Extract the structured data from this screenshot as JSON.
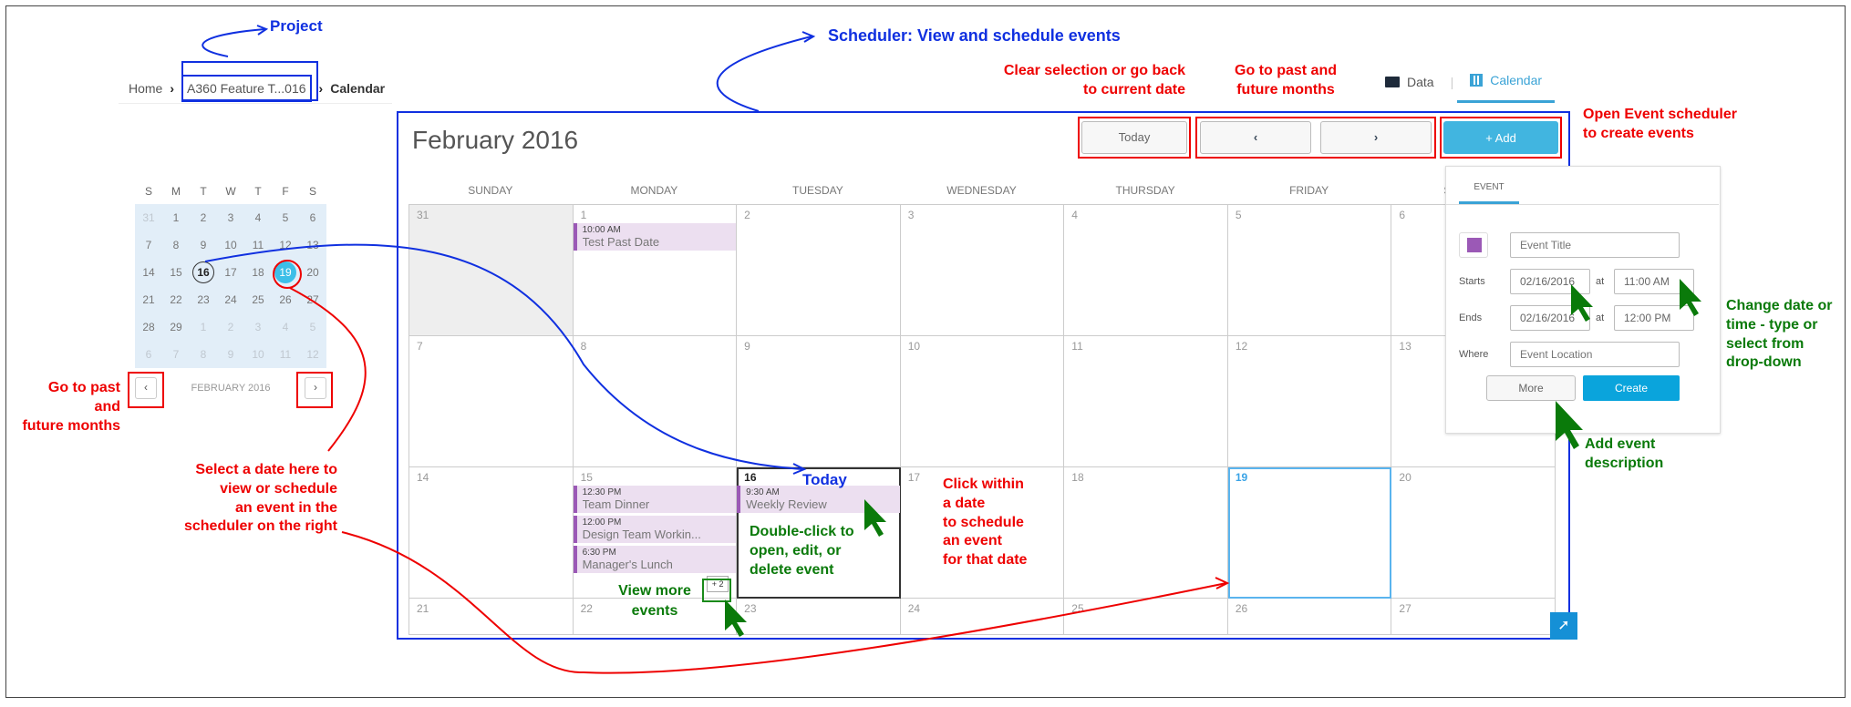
{
  "breadcrumb": {
    "home": "Home",
    "project": "A360 Feature T...016",
    "current": "Calendar"
  },
  "tabs": [
    {
      "label": "Data",
      "icon": "folder-icon"
    },
    {
      "label": "Calendar",
      "icon": "calendar-icon",
      "active": true
    }
  ],
  "mini_calendar": {
    "weekdays": [
      "S",
      "M",
      "T",
      "W",
      "T",
      "F",
      "S"
    ],
    "days": [
      {
        "d": "31",
        "out": true
      },
      {
        "d": "1"
      },
      {
        "d": "2"
      },
      {
        "d": "3"
      },
      {
        "d": "4"
      },
      {
        "d": "5"
      },
      {
        "d": "6"
      },
      {
        "d": "7"
      },
      {
        "d": "8"
      },
      {
        "d": "9"
      },
      {
        "d": "10"
      },
      {
        "d": "11"
      },
      {
        "d": "12"
      },
      {
        "d": "13"
      },
      {
        "d": "14"
      },
      {
        "d": "15"
      },
      {
        "d": "16",
        "today": true
      },
      {
        "d": "17"
      },
      {
        "d": "18"
      },
      {
        "d": "19",
        "selected": true
      },
      {
        "d": "20"
      },
      {
        "d": "21"
      },
      {
        "d": "22"
      },
      {
        "d": "23"
      },
      {
        "d": "24"
      },
      {
        "d": "25"
      },
      {
        "d": "26"
      },
      {
        "d": "27"
      },
      {
        "d": "28"
      },
      {
        "d": "29"
      },
      {
        "d": "1",
        "out": true
      },
      {
        "d": "2",
        "out": true
      },
      {
        "d": "3",
        "out": true
      },
      {
        "d": "4",
        "out": true
      },
      {
        "d": "5",
        "out": true
      },
      {
        "d": "6",
        "out": true
      },
      {
        "d": "7",
        "out": true
      },
      {
        "d": "8",
        "out": true
      },
      {
        "d": "9",
        "out": true
      },
      {
        "d": "10",
        "out": true
      },
      {
        "d": "11",
        "out": true
      },
      {
        "d": "12",
        "out": true
      }
    ],
    "month_label": "FEBRUARY 2016",
    "prev": "‹",
    "next": "›"
  },
  "scheduler": {
    "month_title": "February 2016",
    "today_label": "Today",
    "prev": "‹",
    "next": "›",
    "add_label": "+  Add",
    "weekdays": [
      "SUNDAY",
      "MONDAY",
      "TUESDAY",
      "WEDNESDAY",
      "THURSDAY",
      "FRIDAY",
      "SATURDAY"
    ],
    "cells": [
      {
        "d": "31",
        "past": true
      },
      {
        "d": "1",
        "events": [
          {
            "time": "10:00 AM",
            "name": "Test Past Date"
          }
        ]
      },
      {
        "d": "2"
      },
      {
        "d": "3"
      },
      {
        "d": "4"
      },
      {
        "d": "5"
      },
      {
        "d": "6"
      },
      {
        "d": "7"
      },
      {
        "d": "8"
      },
      {
        "d": "9"
      },
      {
        "d": "10"
      },
      {
        "d": "11"
      },
      {
        "d": "12"
      },
      {
        "d": "13"
      },
      {
        "d": "14"
      },
      {
        "d": "15",
        "events": [
          {
            "time": "12:30 PM",
            "name": "Team Dinner"
          },
          {
            "time": "12:00 PM",
            "name": "Design Team Workin..."
          },
          {
            "time": "6:30 PM",
            "name": "Manager's Lunch"
          }
        ],
        "more": "+ 2"
      },
      {
        "d": "16",
        "today": true,
        "events": [
          {
            "time": "9:30 AM",
            "name": "Weekly Review"
          }
        ]
      },
      {
        "d": "17"
      },
      {
        "d": "18"
      },
      {
        "d": "19",
        "selected": true
      },
      {
        "d": "20"
      },
      {
        "d": "21"
      },
      {
        "d": "22"
      },
      {
        "d": "23"
      },
      {
        "d": "24"
      },
      {
        "d": "25"
      },
      {
        "d": "26"
      },
      {
        "d": "27"
      }
    ]
  },
  "event_panel": {
    "tab": "EVENT",
    "color": "#9b59b6",
    "title_placeholder": "Event Title",
    "starts_label": "Starts",
    "start_date": "02/16/2016",
    "at_label": "at",
    "start_time": "11:00 AM",
    "ends_label": "Ends",
    "end_date": "02/16/2016",
    "end_time": "12:00 PM",
    "where_label": "Where",
    "location_placeholder": "Event Location",
    "more_label": "More",
    "create_label": "Create"
  },
  "annotations": {
    "project": "Project",
    "scheduler": "Scheduler: View and schedule events",
    "clear_selection": [
      "Clear selection or go back",
      "to current date"
    ],
    "past_future_top": [
      "Go to past and",
      "future months"
    ],
    "open_scheduler": [
      "Open Event scheduler",
      "to create events"
    ],
    "change_datetime": [
      "Change date or",
      "time - type or",
      "select from",
      "drop-down"
    ],
    "add_description": [
      "Add event",
      "description"
    ],
    "past_future_left": [
      "Go to past",
      "and",
      "future months"
    ],
    "select_date": [
      "Select a date here to",
      "view or schedule",
      "an event in the",
      "scheduler on the right"
    ],
    "today": "Today",
    "double_click": [
      "Double-click to",
      "open, edit, or",
      "delete event"
    ],
    "view_more": [
      "View more",
      "events"
    ],
    "click_within": [
      "Click within",
      "a date",
      "to schedule",
      "an event",
      "for that date"
    ]
  }
}
